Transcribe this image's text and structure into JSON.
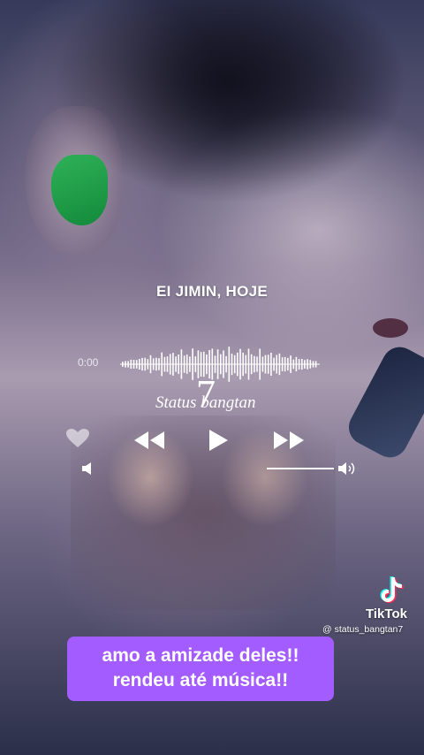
{
  "lyrics": {
    "line": "EI JIMIN, HOJE"
  },
  "player": {
    "time_current": "0:00",
    "brand_text": "Status bangtan",
    "brand_number": "7",
    "icons": {
      "like": "heart-icon",
      "previous": "rewind-icon",
      "play": "play-icon",
      "next": "fast-forward-icon",
      "volume_low": "volume-low-icon",
      "volume_high": "volume-high-icon"
    }
  },
  "tiktok": {
    "brand": "TikTok",
    "handle": "@ status_bangtan7"
  },
  "caption": {
    "line1": "amo a amizade deles!!",
    "line2": "rendeu até música!!"
  },
  "colors": {
    "caption_bg": "#a35cff",
    "earpiece": "#2fb158",
    "tiktok_cyan": "#25f4ee",
    "tiktok_red": "#fe2c55"
  }
}
